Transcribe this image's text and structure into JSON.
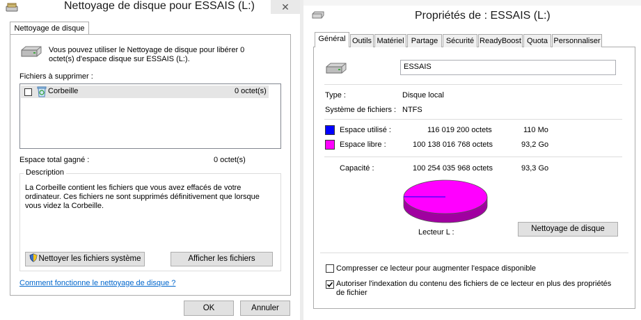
{
  "colors": {
    "used": "#0000ff",
    "free": "#ff00ff",
    "link": "#0066cc"
  },
  "cleanup": {
    "title": "Nettoyage de disque pour ESSAIS (L:)",
    "tab": "Nettoyage de disque",
    "intro": "Vous pouvez utiliser le Nettoyage de disque pour libérer 0 octet(s) d'espace disque sur ESSAIS (L:).",
    "files_label": "Fichiers à supprimer :",
    "files": [
      {
        "name": "Corbeille",
        "size": "0 octet(s)",
        "checked": false
      }
    ],
    "total_label": "Espace total gagné :",
    "total_value": "0 octet(s)",
    "description_label": "Description",
    "description_text": "La Corbeille contient les fichiers que vous avez effacés de votre ordinateur. Ces fichiers ne sont supprimés définitivement que lorsque vous videz la Corbeille.",
    "clean_system_button": "Nettoyer les fichiers système",
    "view_files_button": "Afficher les fichiers",
    "help_link": "Comment fonctionne le nettoyage de disque ?",
    "ok_button": "OK",
    "cancel_button": "Annuler"
  },
  "properties": {
    "title": "Propriétés de : ESSAIS (L:)",
    "tabs": [
      "Général",
      "Outils",
      "Matériel",
      "Partage",
      "Sécurité",
      "ReadyBoost",
      "Quota",
      "Personnaliser"
    ],
    "active_tab": "Général",
    "name_value": "ESSAIS",
    "type_label": "Type :",
    "type_value": "Disque local",
    "fs_label": "Système de fichiers :",
    "fs_value": "NTFS",
    "used_label": "Espace utilisé :",
    "used_bytes": "116 019 200 octets",
    "used_size": "110 Mo",
    "free_label": "Espace libre :",
    "free_bytes": "100 138 016 768 octets",
    "free_size": "93,2 Go",
    "capacity_label": "Capacité :",
    "capacity_bytes": "100 254 035 968 octets",
    "capacity_size": "93,3 Go",
    "used_fraction": 0.00116,
    "drive_label": "Lecteur L :",
    "cleanup_button": "Nettoyage de disque",
    "compress_label": "Compresser ce lecteur pour augmenter l'espace disponible",
    "compress_checked": false,
    "index_label": "Autoriser l'indexation du contenu des fichiers de ce lecteur en plus des propriétés de fichier",
    "index_checked": true
  }
}
